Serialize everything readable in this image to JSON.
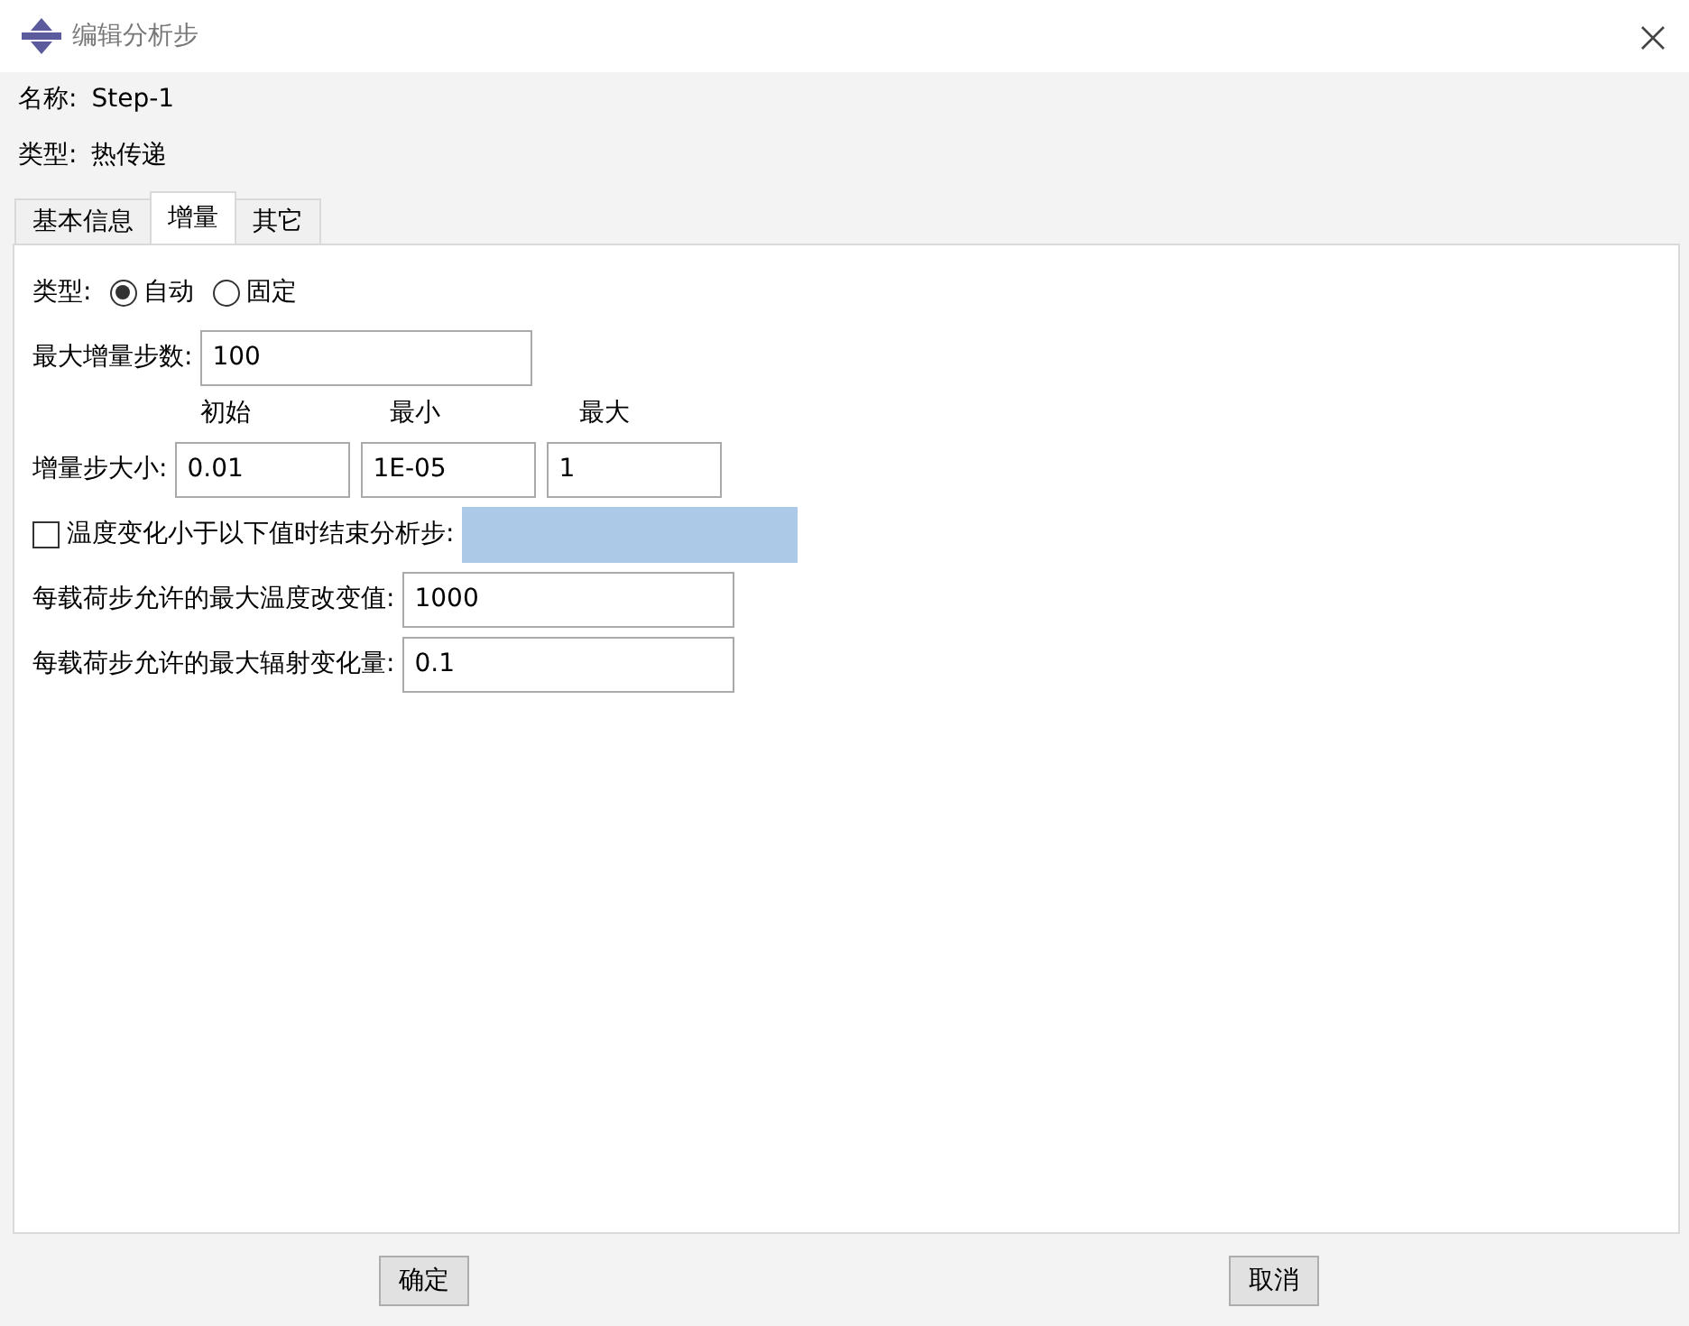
{
  "window": {
    "title": "编辑分析步"
  },
  "name": {
    "label": "名称:",
    "value": "Step-1"
  },
  "type": {
    "label": "类型:",
    "value": "热传递"
  },
  "tabs": [
    {
      "label": "基本信息",
      "selected": false
    },
    {
      "label": "增量",
      "selected": true
    },
    {
      "label": "其它",
      "selected": false
    }
  ],
  "increment": {
    "type": {
      "label": "类型:",
      "options": [
        {
          "label": "自动",
          "selected": true
        },
        {
          "label": "固定",
          "selected": false
        }
      ]
    },
    "max_increments": {
      "label": "最大增量步数:",
      "value": "100"
    },
    "size": {
      "label": "增量步大小:",
      "columns": [
        "初始",
        "最小",
        "最大"
      ],
      "values": [
        "0.01",
        "1E-05",
        "1"
      ]
    },
    "end_condition": {
      "label": "温度变化小于以下值时结束分析步:",
      "checked": false
    },
    "fields": [
      {
        "label": "每载荷步允许的最大温度改变值:",
        "value": "1000"
      },
      {
        "label": "每载荷步允许的最大辐射变化量:",
        "value": "0.1"
      }
    ]
  },
  "buttons": [
    "确定",
    "取消"
  ]
}
